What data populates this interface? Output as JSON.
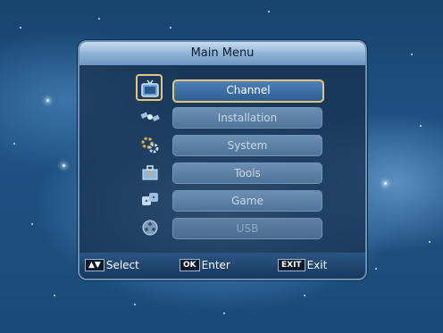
{
  "menu": {
    "title": "Main Menu",
    "items": [
      {
        "label": "Channel",
        "icon": "tv-icon",
        "state": "selected"
      },
      {
        "label": "Installation",
        "icon": "satellite-icon",
        "state": "normal"
      },
      {
        "label": "System",
        "icon": "gears-icon",
        "state": "normal"
      },
      {
        "label": "Tools",
        "icon": "toolbox-icon",
        "state": "normal"
      },
      {
        "label": "Game",
        "icon": "dice-icon",
        "state": "normal"
      },
      {
        "label": "USB",
        "icon": "film-reel-icon",
        "state": "disabled"
      }
    ]
  },
  "footer": {
    "select": {
      "key": "▲▼",
      "label": "Select"
    },
    "enter": {
      "key": "OK",
      "label": "Enter"
    },
    "exit": {
      "key": "EXIT",
      "label": "Exit"
    }
  },
  "colors": {
    "selection_border": "#e3c77c",
    "title_bar": "#8fb3d6",
    "panel": "#19324f"
  }
}
